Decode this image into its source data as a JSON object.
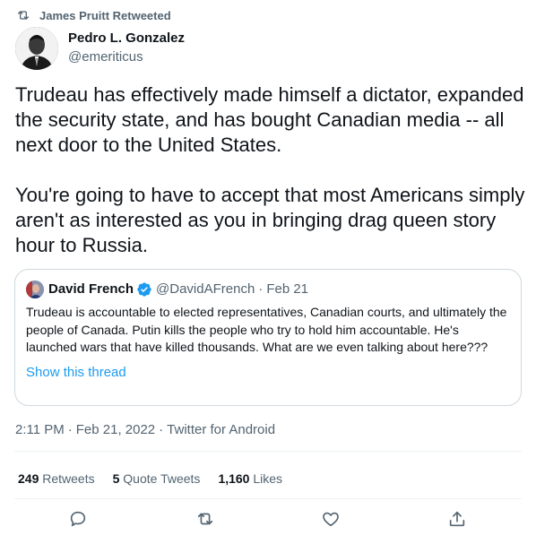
{
  "retweet_context": {
    "text": "James Pruitt Retweeted",
    "icon": "retweet-icon"
  },
  "author": {
    "name": "Pedro L. Gonzalez",
    "handle": "@emeriticus",
    "avatar": "profile-photo"
  },
  "tweet": {
    "paragraphs": [
      "Trudeau has effectively made himself a dictator, expanded the security state, and has bought Canadian media -- all next door to the United States.",
      "You're going to have to accept that most Americans simply aren't as interested as you in bringing drag queen story hour to Russia."
    ]
  },
  "quoted_tweet": {
    "name": "David French",
    "verified": true,
    "handle": "@DavidAFrench",
    "separator": "·",
    "date": "Feb 21",
    "text": "Trudeau is accountable to elected representatives, Canadian courts, and ultimately the people of Canada. Putin kills the people who try to hold him accountable. He's launched wars that have killed thousands. What are we even talking about here???",
    "show_thread": "Show this thread"
  },
  "meta": {
    "time": "2:11 PM",
    "sep1": "·",
    "date": "Feb 21, 2022",
    "sep2": "·",
    "source": "Twitter for Android"
  },
  "stats": {
    "retweets_count": "249",
    "retweets_label": "Retweets",
    "quotes_count": "5",
    "quotes_label": "Quote Tweets",
    "likes_count": "1,160",
    "likes_label": "Likes"
  },
  "actions": [
    "reply-icon",
    "retweet-icon",
    "like-icon",
    "share-icon"
  ],
  "colors": {
    "link": "#1d9bf0",
    "secondary": "#536471",
    "border": "#cfd9de",
    "text": "#0f1419"
  }
}
